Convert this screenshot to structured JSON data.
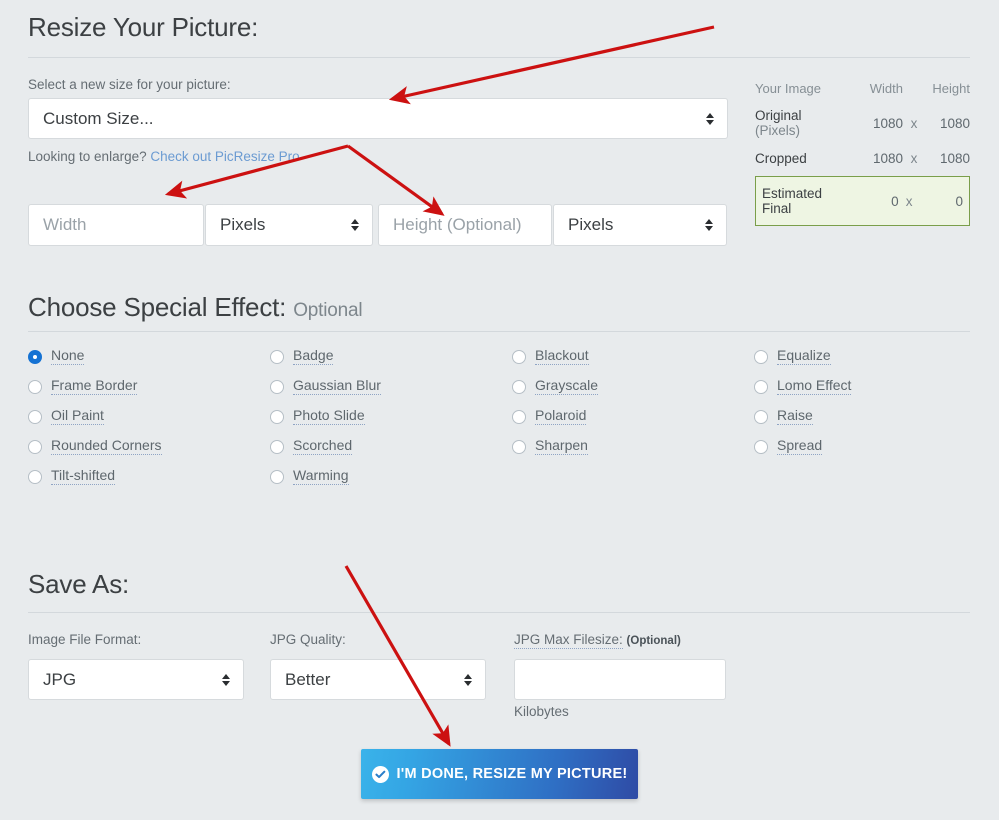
{
  "resize": {
    "title": "Resize Your Picture:",
    "size_label": "Select a new size for your picture:",
    "size_select_value": "Custom Size...",
    "enlarge_prefix": "Looking to enlarge?",
    "enlarge_link": "Check out PicResize Pro",
    "width_placeholder": "Width",
    "width_unit": "Pixels",
    "height_placeholder": "Height (Optional)",
    "height_unit": "Pixels"
  },
  "stats": {
    "header": {
      "name": "Your Image",
      "width": "Width",
      "height": "Height"
    },
    "x_symbol": "x",
    "rows": [
      {
        "name": "Original",
        "name2": "(Pixels)",
        "width": "1080",
        "height": "1080"
      },
      {
        "name": "Cropped",
        "name2": "",
        "width": "1080",
        "height": "1080"
      }
    ],
    "estimated": {
      "name": "Estimated",
      "name2": "Final",
      "width": "0",
      "height": "0"
    }
  },
  "effects": {
    "title": "Choose Special Effect:",
    "subtitle": "Optional",
    "selected": "None",
    "items": [
      "None",
      "Badge",
      "Blackout",
      "Equalize",
      "Frame Border",
      "Gaussian Blur",
      "Grayscale",
      "Lomo Effect",
      "Oil Paint",
      "Photo Slide",
      "Polaroid",
      "Raise",
      "Rounded Corners",
      "Scorched",
      "Sharpen",
      "Spread",
      "Tilt-shifted",
      "Warming"
    ]
  },
  "save": {
    "title": "Save As:",
    "format_label": "Image File Format:",
    "format_value": "JPG",
    "quality_label": "JPG Quality:",
    "quality_value": "Better",
    "filesize_label": "JPG Max Filesize:",
    "filesize_optional": "(Optional)",
    "filesize_value": "",
    "filesize_unit": "Kilobytes"
  },
  "submit": {
    "label": "I'M DONE, RESIZE MY PICTURE!",
    "icon": "check-circle-icon"
  },
  "colors": {
    "background": "#e8ebed",
    "accent_blue": "#1572d3",
    "button_gradient_start": "#3ab3ea",
    "button_gradient_end": "#2f4ba5",
    "estimated_border": "#7a9e4a",
    "estimated_bg": "#eef5e3",
    "annotation_red": "#cc1111",
    "link_blue": "#6b9bd2"
  }
}
